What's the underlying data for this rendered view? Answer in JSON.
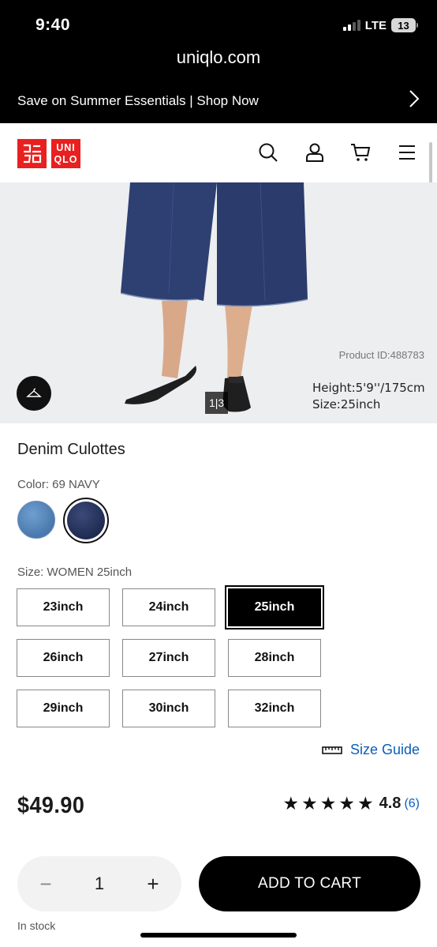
{
  "status_bar": {
    "time": "9:40",
    "network": "LTE",
    "battery": "13"
  },
  "browser": {
    "url": "uniqlo.com"
  },
  "promo_banner": {
    "text": "Save on Summer Essentials | Shop Now"
  },
  "header": {
    "logo_top": "ユニ\nクロ",
    "logo_bottom": "UNI\nQLO",
    "icons": [
      "search-icon",
      "account-icon",
      "cart-icon",
      "menu-icon"
    ]
  },
  "hero": {
    "product_id": "Product ID:488783",
    "model_height": "Height:5'9''/175cm",
    "model_size": "Size:25inch",
    "pager": "1|3"
  },
  "product": {
    "title": "Denim Culottes",
    "color_label": "Color: 69 NAVY",
    "size_label": "Size: WOMEN 25inch",
    "sizes": [
      {
        "label": "23inch",
        "selected": false
      },
      {
        "label": "24inch",
        "selected": false
      },
      {
        "label": "25inch",
        "selected": true
      },
      {
        "label": "26inch",
        "selected": false
      },
      {
        "label": "27inch",
        "selected": false
      },
      {
        "label": "28inch",
        "selected": false
      },
      {
        "label": "29inch",
        "selected": false
      },
      {
        "label": "30inch",
        "selected": false
      },
      {
        "label": "32inch",
        "selected": false
      }
    ],
    "size_guide": "Size Guide",
    "price": "$49.90",
    "stars": "★★★★★",
    "rating": "4.8",
    "review_count": "(6)"
  },
  "cart": {
    "quantity": "1",
    "minus": "−",
    "plus": "+",
    "add_to_cart": "ADD TO CART",
    "stock_status": "In stock"
  },
  "colors": {
    "brand_red": "#e8201f",
    "link_blue": "#0b5fb8"
  }
}
